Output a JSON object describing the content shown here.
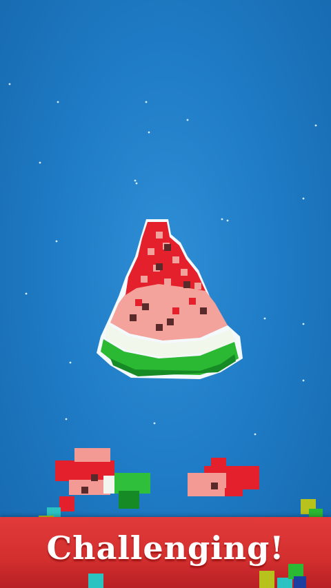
{
  "banner": {
    "text": "Challenging!"
  },
  "colors": {
    "background": "#1f7cc6",
    "banner": "#d32f2f",
    "watermelon_red": "#e8202a",
    "watermelon_pink": "#f29c96",
    "rind_white": "#f4f8ee",
    "rind_green": "#2fbf3a",
    "seed": "#5a2a2a"
  },
  "icons": {
    "main_object": "watermelon-slice-voxel",
    "fragments": [
      "watermelon-fragment-left",
      "watermelon-fragment-right"
    ],
    "decor": "voxel-cube"
  }
}
